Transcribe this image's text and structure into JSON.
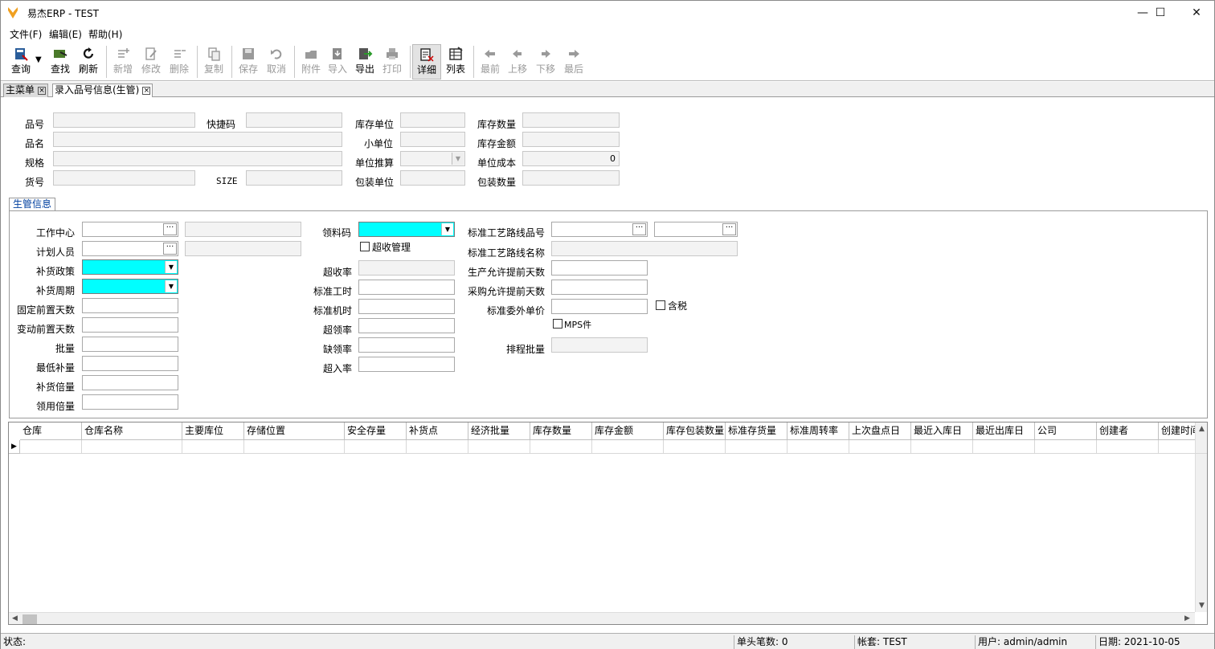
{
  "window": {
    "title": "易杰ERP - TEST",
    "controls": {
      "minimize": "—",
      "maximize": "☐",
      "close": "✕"
    }
  },
  "menu": [
    "文件(F)",
    "编辑(E)",
    "帮助(H)"
  ],
  "toolbar": {
    "query": "查询",
    "find": "查找",
    "refresh": "刷新",
    "add": "新增",
    "edit": "修改",
    "delete": "删除",
    "copy": "复制",
    "save": "保存",
    "cancel": "取消",
    "attach": "附件",
    "import": "导入",
    "export": "导出",
    "print": "打印",
    "detail": "详细",
    "list": "列表",
    "first": "最前",
    "prev": "上移",
    "next": "下移",
    "last": "最后"
  },
  "tabs": [
    "主菜单",
    "录入品号信息(生管)"
  ],
  "header_form": {
    "item_no": "品号",
    "quick_code": "快捷码",
    "name": "品名",
    "spec": "规格",
    "goods_no": "货号",
    "size": "SIZE",
    "stock_unit": "库存单位",
    "small_unit": "小单位",
    "unit_calc": "单位推算",
    "pack_unit": "包装单位",
    "stock_qty": "库存数量",
    "stock_amount": "库存金额",
    "unit_cost": "单位成本",
    "unit_cost_value": "0",
    "pack_qty": "包装数量"
  },
  "group": {
    "tab": "生管信息",
    "work_center": "工作中心",
    "planner": "计划人员",
    "replenish_policy": "补货政策",
    "replenish_cycle": "补货周期",
    "fixed_lead": "固定前置天数",
    "var_lead": "变动前置天数",
    "batch": "批量",
    "min_replenish": "最低补量",
    "replenish_multiple": "补货倍量",
    "issue_multiple": "领用倍量",
    "issue_code": "领料码",
    "over_receipt_mgmt": "超收管理",
    "over_receipt_rate": "超收率",
    "std_labor_hours": "标准工时",
    "std_machine_hours": "标准机时",
    "over_issue_rate": "超领率",
    "short_issue_rate": "缺领率",
    "over_in_rate": "超入率",
    "route_no": "标准工艺路线品号",
    "route_name": "标准工艺路线名称",
    "prod_allow_days": "生产允许提前天数",
    "purch_allow_days": "采购允许提前天数",
    "outsource_price": "标准委外单价",
    "tax_incl": "含税",
    "mps": "MPS件",
    "schedule_batch": "排程批量"
  },
  "grid": {
    "columns": [
      "仓库",
      "仓库名称",
      "主要库位",
      "存储位置",
      "安全存量",
      "补货点",
      "经济批量",
      "库存数量",
      "库存金额",
      "库存包装数量",
      "标准存货量",
      "标准周转率",
      "上次盘点日",
      "最近入库日",
      "最近出库日",
      "公司",
      "创建者",
      "创建时间"
    ]
  },
  "status": {
    "state": "状态:",
    "doc_count": "单头笔数: 0",
    "account": "帐套: TEST",
    "user": "用户: admin/admin",
    "date": "日期: 2021-10-05"
  }
}
